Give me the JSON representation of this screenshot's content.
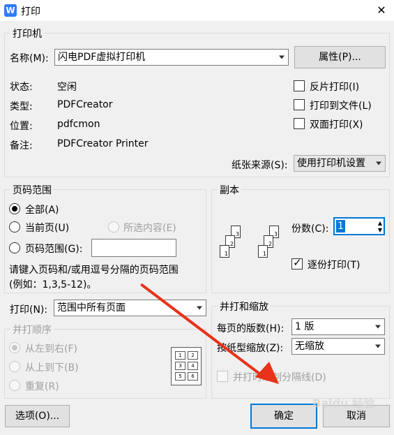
{
  "window": {
    "title": "打印",
    "close": "✕",
    "app_icon_letter": "W"
  },
  "printer": {
    "group_label": "打印机",
    "name_label": "名称(M):",
    "name_value": "闪电PDF虚拟打印机",
    "properties_button": "属性(P)...",
    "status_label": "状态:",
    "status_value": "空闲",
    "type_label": "类型:",
    "type_value": "PDFCreator",
    "location_label": "位置:",
    "location_value": "pdfcmon",
    "comment_label": "备注:",
    "comment_value": "PDFCreator Printer",
    "reverse_print": "反片打印(I)",
    "print_to_file": "打印到文件(L)",
    "duplex": "双面打印(X)",
    "paper_source_label": "纸张来源(S):",
    "paper_source_value": "使用打印机设置"
  },
  "page_range": {
    "group_label": "页码范围",
    "all": "全部(A)",
    "current": "当前页(U)",
    "selection": "所选内容(E)",
    "range": "页码范围(G):",
    "range_value": "",
    "hint_line1": "请键入页码和/或用逗号分隔的页码范围",
    "hint_line2": "(例如：1,3,5-12)。"
  },
  "copies": {
    "group_label": "副本",
    "count_label": "份数(C):",
    "count_value": "1",
    "collate": "逐份打印(T)",
    "page_numbers": [
      "1",
      "2",
      "3"
    ]
  },
  "print_what": {
    "label": "打印(N):",
    "value": "范围中所有页面"
  },
  "order": {
    "group_label": "并打顺序",
    "left_right": "从左到右(F)",
    "top_bottom": "从上到下(B)",
    "repeat": "重复(R)",
    "grid_numbers": [
      "1",
      "2",
      "3",
      "4",
      "5",
      "6"
    ]
  },
  "zoom": {
    "group_label": "并打和缩放",
    "pages_per_sheet_label": "每页的版数(H):",
    "pages_per_sheet_value": "1 版",
    "scale_label": "按纸型缩放(Z):",
    "scale_value": "无缩放",
    "divider": "并打时绘制分隔线(D)"
  },
  "buttons": {
    "options": "选项(O)...",
    "ok": "确定",
    "cancel": "取消"
  },
  "watermark": "Baidu 经验",
  "colors": {
    "arrow": "#e8321a",
    "focus_border": "#0078d7",
    "selection": "#0078d7"
  }
}
